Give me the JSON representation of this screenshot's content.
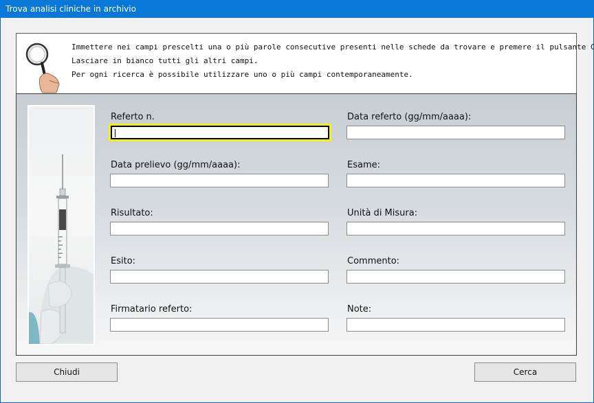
{
  "window": {
    "title": "Trova analisi cliniche in archivio"
  },
  "info": {
    "icon": "magnifier-icon",
    "lines": [
      "Immettere nei campi prescelti una o più parole consecutive presenti nelle schede da trovare e premere il pulsante Cerca.",
      "Lasciare in bianco tutti gli altri campi.",
      "Per ogni ricerca è possibile utilizzare uno o più campi contemporaneamente."
    ]
  },
  "form": {
    "image": "syringe-image",
    "fields": [
      {
        "label": "Referto n.",
        "value": "",
        "focused": true
      },
      {
        "label": "Data referto (gg/mm/aaaa):",
        "value": ""
      },
      {
        "label": "Data prelievo (gg/mm/aaaa):",
        "value": ""
      },
      {
        "label": "Esame:",
        "value": ""
      },
      {
        "label": "Risultato:",
        "value": ""
      },
      {
        "label": "Unità di Misura:",
        "value": ""
      },
      {
        "label": "Esito:",
        "value": ""
      },
      {
        "label": "Commento:",
        "value": ""
      },
      {
        "label": "Firmatario referto:",
        "value": ""
      },
      {
        "label": "Note:",
        "value": ""
      }
    ]
  },
  "buttons": {
    "close_label": "Chiudi",
    "search_label": "Cerca"
  },
  "colors": {
    "title_bar": "#0a78d7",
    "focus_highlight": "#f2f20a"
  }
}
